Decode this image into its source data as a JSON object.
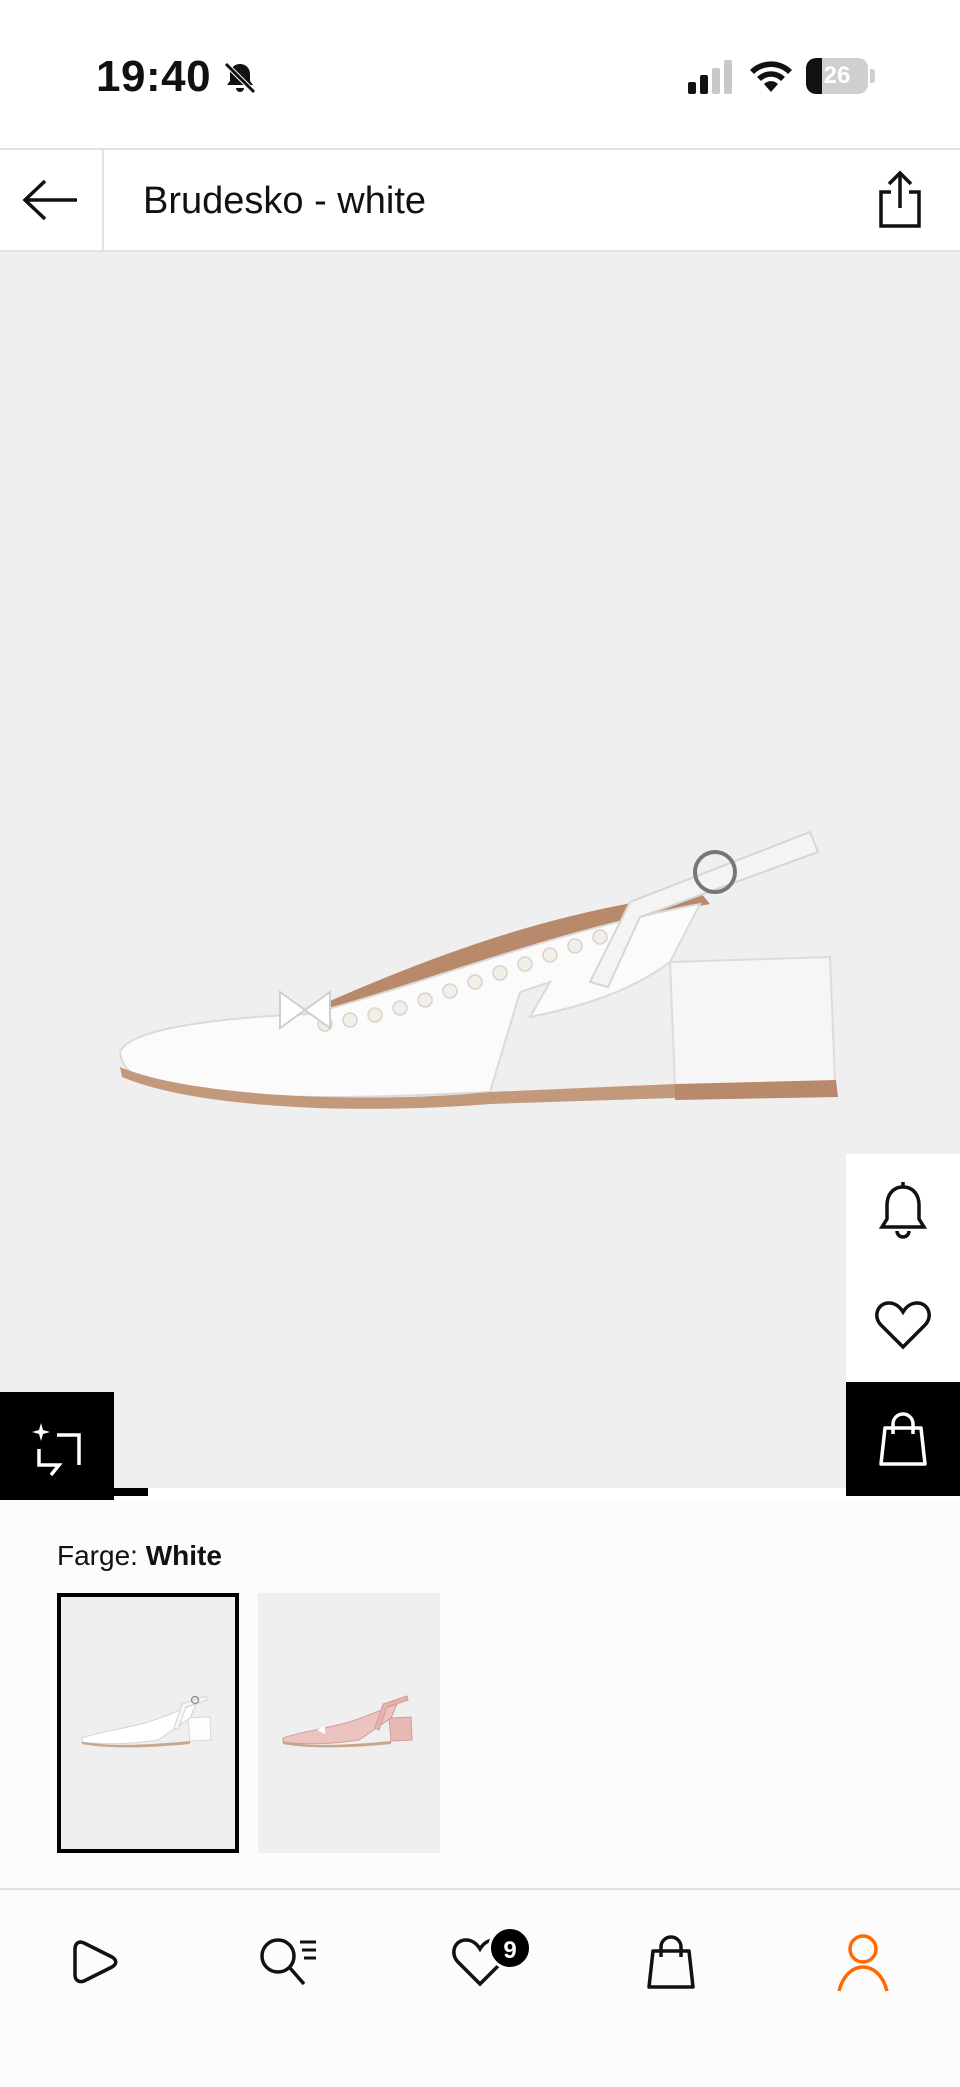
{
  "status_bar": {
    "time": "19:40",
    "battery_level": "26",
    "battery_fraction": 0.26
  },
  "header": {
    "title": "Brudesko - white",
    "back_icon": "arrow-left-icon",
    "share_icon": "share-icon"
  },
  "product": {
    "image_icon": "shoe-image",
    "gallery_progress_fraction": 0.05,
    "side_actions": [
      {
        "name": "notify-button",
        "icon": "bell-icon"
      },
      {
        "name": "wishlist-button",
        "icon": "heart-icon"
      },
      {
        "name": "add-to-bag-button",
        "icon": "bag-icon"
      }
    ],
    "similar_icon": "sparkle-crop-icon"
  },
  "color": {
    "label_prefix": "Farge: ",
    "selected": "White",
    "swatches": [
      {
        "name": "White",
        "shoe_color": "#ffffff",
        "selected": true
      },
      {
        "name": "Pink",
        "shoe_color": "#e8b8b5",
        "selected": false
      }
    ]
  },
  "bottom_nav": {
    "items": [
      {
        "name": "discover",
        "icon": "play-icon"
      },
      {
        "name": "search",
        "icon": "search-list-icon"
      },
      {
        "name": "wishlist",
        "icon": "heart-icon",
        "badge": "9"
      },
      {
        "name": "bag",
        "icon": "bag-icon"
      },
      {
        "name": "profile",
        "icon": "user-icon",
        "active": true
      }
    ],
    "active_color": "#ff6900"
  }
}
